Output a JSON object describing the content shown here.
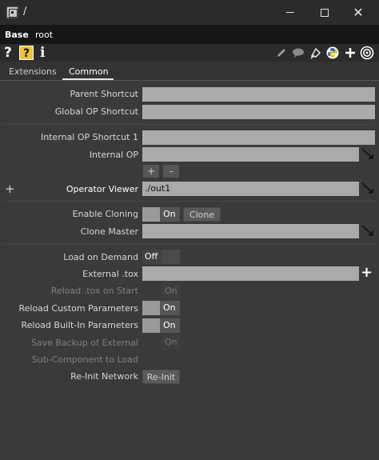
{
  "window": {
    "title": "/",
    "minimize": "minimize",
    "maximize": "maximize",
    "close": "✕"
  },
  "op": {
    "type": "Base",
    "name": "root"
  },
  "toolbar": {
    "help": "?",
    "python_help": "?",
    "info": "i",
    "icons": [
      "pencil-icon",
      "comment-icon",
      "clone-icon",
      "python-icon",
      "plus-icon",
      "target-icon"
    ]
  },
  "tabs": [
    {
      "label": "Extensions",
      "active": false
    },
    {
      "label": "Common",
      "active": true
    }
  ],
  "params": {
    "parent_shortcut": {
      "label": "Parent Shortcut",
      "value": ""
    },
    "global_op_shortcut": {
      "label": "Global OP Shortcut",
      "value": ""
    },
    "internal_op_shortcut_1": {
      "label": "Internal OP Shortcut 1",
      "value": ""
    },
    "internal_op": {
      "label": "Internal OP",
      "value": ""
    },
    "seq_add": "+",
    "seq_remove": "-",
    "add_sequence_block": "+",
    "operator_viewer": {
      "label": "Operator Viewer",
      "value": "./out1"
    },
    "enable_cloning": {
      "label": "Enable Cloning",
      "state": "On",
      "button": "Clone"
    },
    "clone_master": {
      "label": "Clone Master",
      "value": ""
    },
    "load_on_demand": {
      "label": "Load on Demand",
      "state": "Off"
    },
    "external_tox": {
      "label": "External .tox",
      "value": ""
    },
    "reload_tox_on_start": {
      "label": "Reload .tox on Start",
      "state": "On"
    },
    "reload_custom_parameters": {
      "label": "Reload Custom Parameters",
      "state": "On"
    },
    "reload_builtin_parameters": {
      "label": "Reload Built-In Parameters",
      "state": "On"
    },
    "save_backup_of_external": {
      "label": "Save Backup of External",
      "state": "On"
    },
    "sub_component_to_load": {
      "label": "Sub-Component to Load"
    },
    "reinit_network": {
      "label": "Re-Init Network",
      "button": "Re-Init"
    }
  },
  "colors": {
    "background": "#3a3a3a",
    "field": "#aaaaaa",
    "titlebar": "#2b2b2b",
    "python_badge": "#e8c33a"
  }
}
